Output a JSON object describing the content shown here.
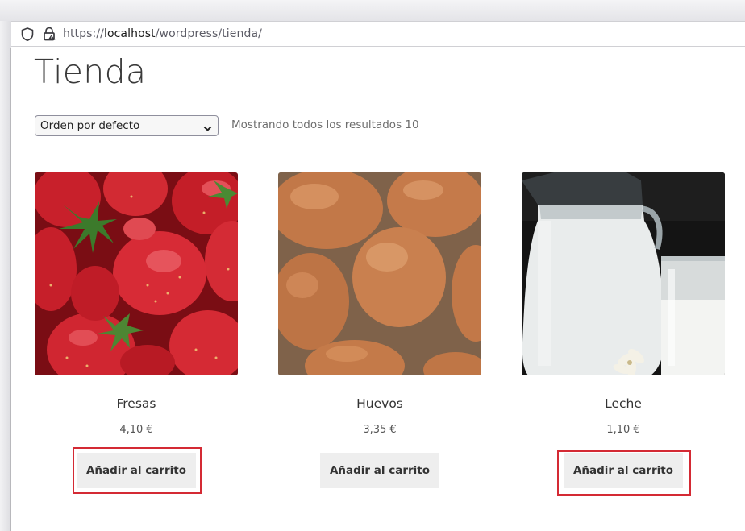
{
  "browser": {
    "url_prefix": "https://",
    "url_host": "localhost",
    "url_path": "/wordpress/tienda/"
  },
  "page": {
    "title": "Tienda"
  },
  "toolbar": {
    "sort_selected": "Orden por defecto",
    "result_count": "Mostrando todos los resultados 10"
  },
  "products": [
    {
      "name": "Fresas",
      "price": "4,10 €",
      "button": "Añadir al carrito",
      "highlighted": true
    },
    {
      "name": "Huevos",
      "price": "3,35 €",
      "button": "Añadir al carrito",
      "highlighted": false
    },
    {
      "name": "Leche",
      "price": "1,10 €",
      "button": "Añadir al carrito",
      "highlighted": true
    }
  ],
  "colors": {
    "highlight": "#d42a34",
    "button_bg": "#eeeeee"
  },
  "icons": {
    "shield": "shield-icon",
    "lock": "lock-icon",
    "chevron": "chevron-down-icon"
  }
}
